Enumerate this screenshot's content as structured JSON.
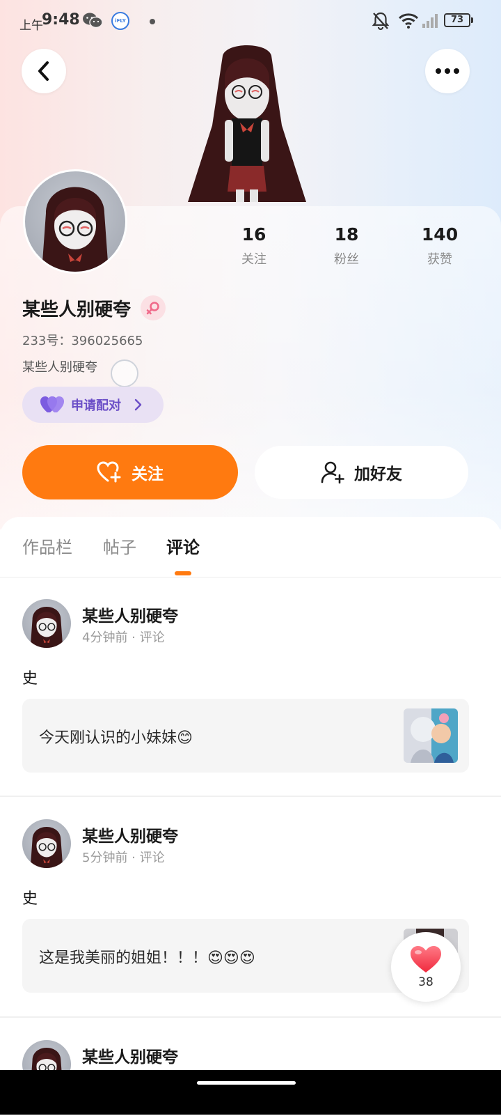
{
  "status_bar": {
    "time_prefix": "上午",
    "time": "9:48",
    "battery": "73"
  },
  "profile": {
    "username": "某些人别硬夸",
    "uid": "233号：396025665",
    "bio": "某些人别硬夸",
    "stats": [
      {
        "value": "16",
        "label": "关注"
      },
      {
        "value": "18",
        "label": "粉丝"
      },
      {
        "value": "140",
        "label": "获赞"
      }
    ]
  },
  "actions": {
    "pair_label": "申请配对",
    "follow_label": "关注",
    "add_friend_label": "加好友"
  },
  "tabs": [
    {
      "label": "作品栏",
      "active": false
    },
    {
      "label": "帖子",
      "active": false
    },
    {
      "label": "评论",
      "active": true
    }
  ],
  "posts": [
    {
      "name": "某些人别硬夸",
      "meta": "4分钟前 · 评论",
      "text": "史",
      "quote": "今天刚认识的小妹妹😊"
    },
    {
      "name": "某些人别硬夸",
      "meta": "5分钟前 · 评论",
      "text": "史",
      "quote": "这是我美丽的姐姐！！！😍😍😍"
    },
    {
      "name": "某些人别硬夸"
    }
  ],
  "like_button": {
    "count": "38"
  },
  "colors": {
    "accent": "#ff7a10",
    "pair_text": "#6b4ec7",
    "pair_bg": "#e9e1f4",
    "female_badge": "#f06a8a"
  }
}
